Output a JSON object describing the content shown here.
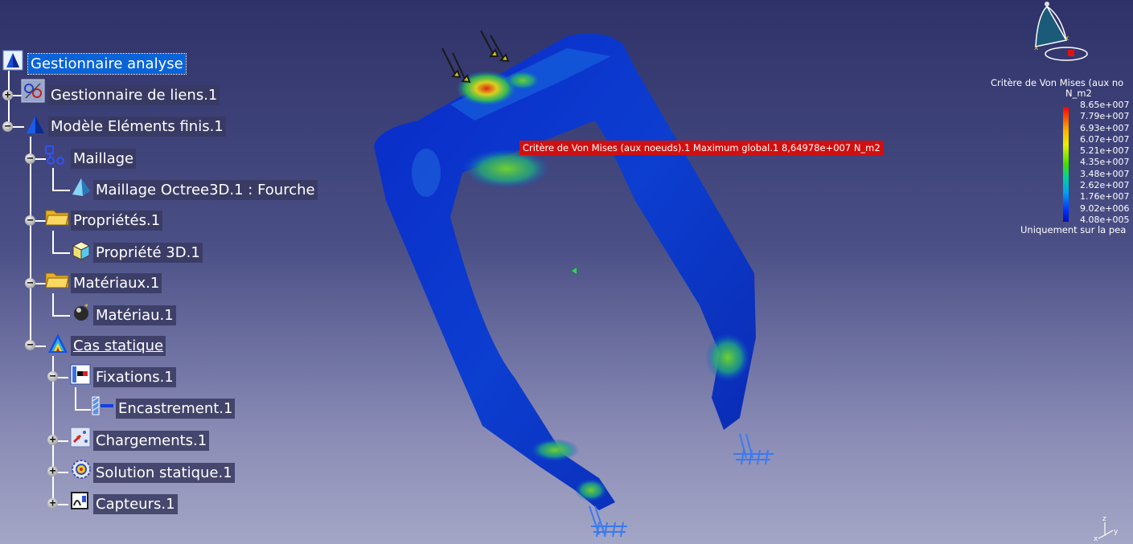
{
  "tree": {
    "root_label": "Gestionnaire analyse",
    "nodes": [
      {
        "label": "Gestionnaire de liens.1",
        "expander": "+"
      },
      {
        "label": "Modèle Eléments finis.1",
        "expander": "−"
      },
      {
        "label": "Maillage",
        "expander": "−"
      },
      {
        "label": "Maillage Octree3D.1 : Fourche",
        "expander": ""
      },
      {
        "label": "Propriétés.1",
        "expander": "−"
      },
      {
        "label": "Propriété 3D.1",
        "expander": ""
      },
      {
        "label": "Matériaux.1",
        "expander": "−"
      },
      {
        "label": "Matériau.1",
        "expander": ""
      },
      {
        "label": "Cas statique",
        "expander": "−"
      },
      {
        "label": "Fixations.1",
        "expander": "−"
      },
      {
        "label": "Encastrement.1",
        "expander": ""
      },
      {
        "label": "Chargements.1",
        "expander": "+"
      },
      {
        "label": "Solution statique.1",
        "expander": "+"
      },
      {
        "label": "Capteurs.1",
        "expander": "+"
      }
    ]
  },
  "viewport": {
    "tooltip": "Critère de Von Mises (aux noeuds).1  Maximum global.1  8,64978e+007 N_m2"
  },
  "legend": {
    "title": "Critère de Von Mises (aux no",
    "unit": "N_m2",
    "values": [
      "8.65e+007",
      "7.79e+007",
      "6.93e+007",
      "6.07e+007",
      "5.21e+007",
      "4.35e+007",
      "3.48e+007",
      "2.62e+007",
      "1.76e+007",
      "9.02e+006",
      "4.08e+005"
    ],
    "footer": "Uniquement sur la pea"
  },
  "axes": {
    "z": "z",
    "x": "x",
    "y": "y"
  },
  "colors": {
    "selection": "#0a64d8",
    "tooltip": "#d01010",
    "background_top": "#2e3268",
    "background_bottom": "#a4a6c6"
  }
}
